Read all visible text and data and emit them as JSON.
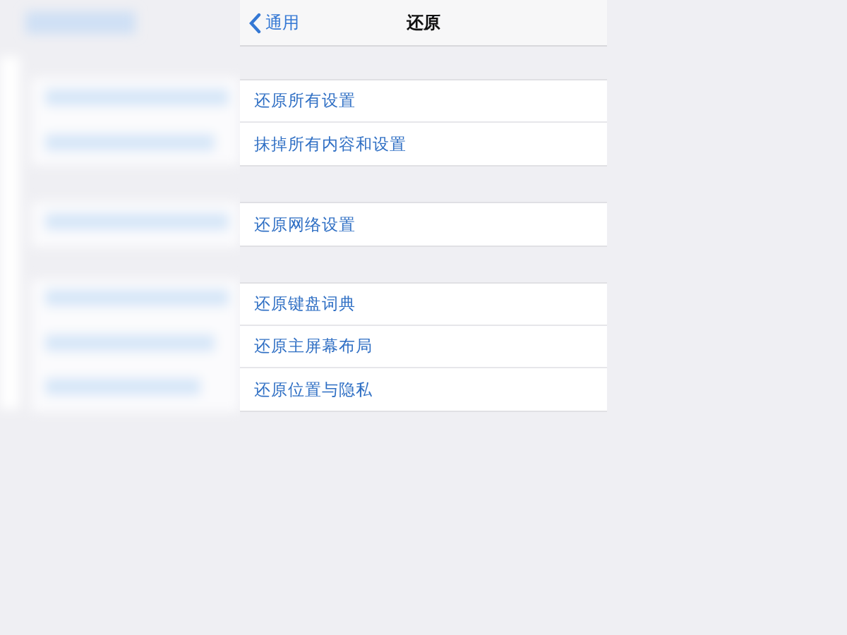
{
  "nav_bar": {
    "back_label": "通用",
    "title": "还原"
  },
  "groups": [
    {
      "items": [
        {
          "label": "还原所有设置"
        },
        {
          "label": "抹掉所有内容和设置"
        }
      ]
    },
    {
      "items": [
        {
          "label": "还原网络设置"
        }
      ]
    },
    {
      "items": [
        {
          "label": "还原键盘词典"
        },
        {
          "label": "还原主屏幕布局"
        },
        {
          "label": "还原位置与隐私"
        }
      ]
    }
  ]
}
